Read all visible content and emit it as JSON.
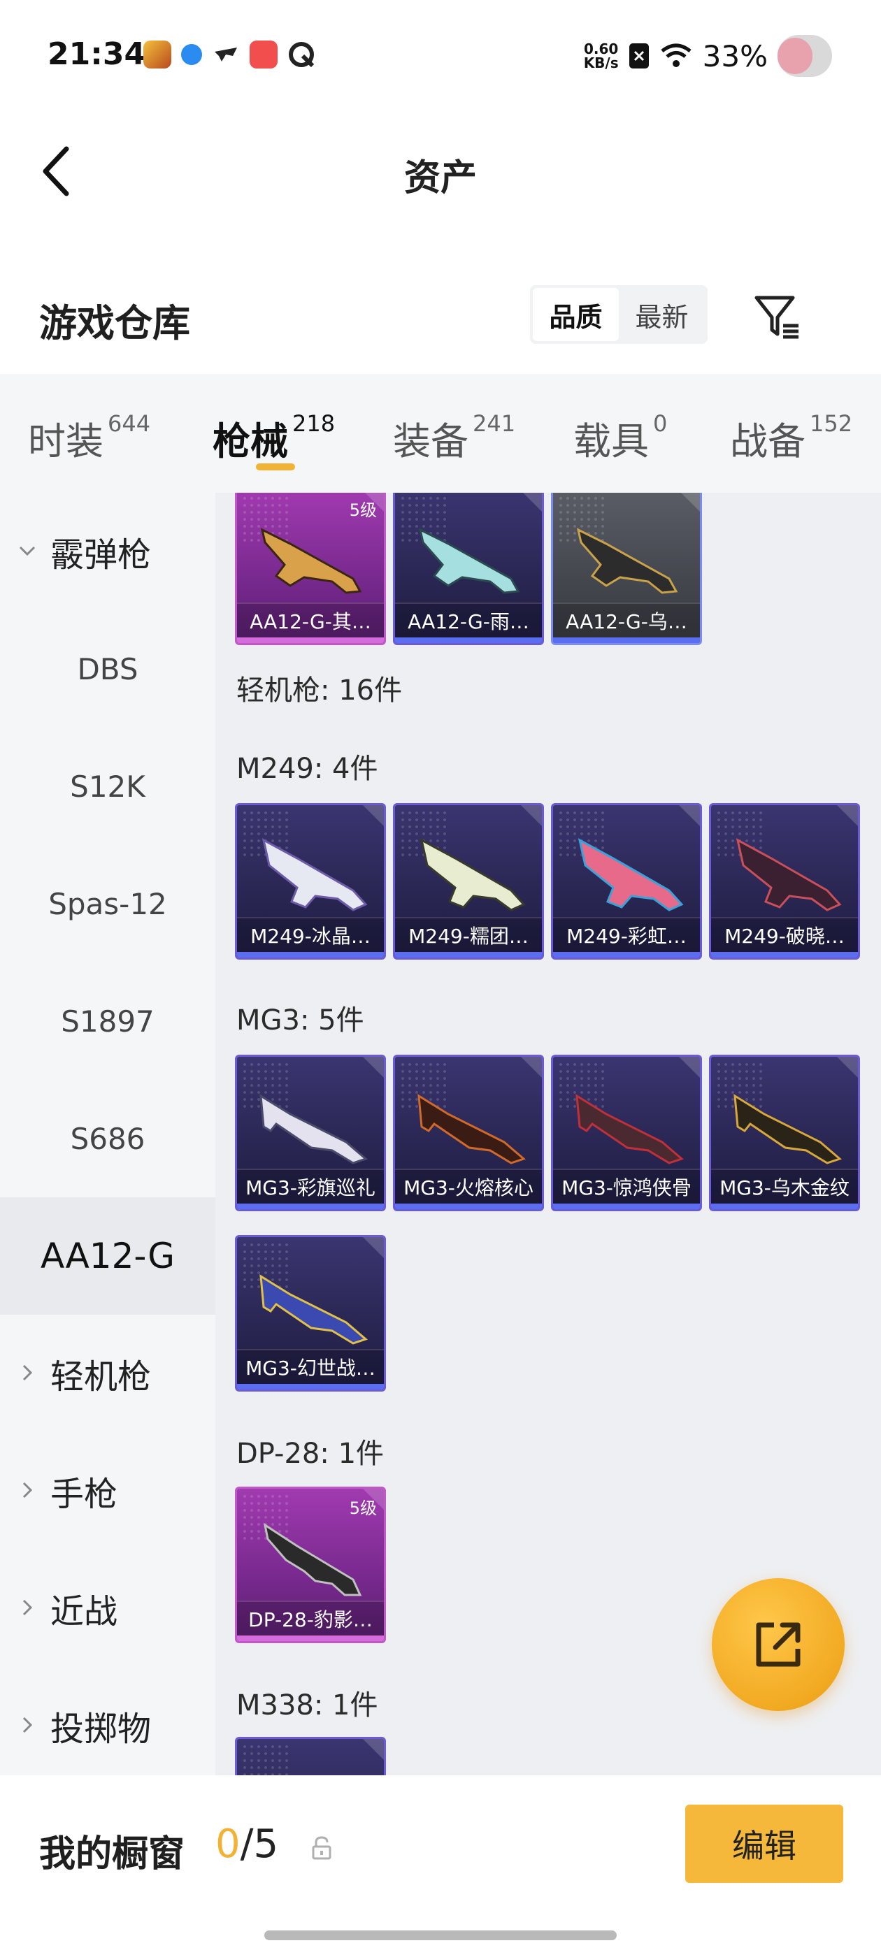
{
  "status_bar": {
    "time": "21:34",
    "net_speed_value": "0.60",
    "net_speed_unit": "KB/s",
    "battery": "33%",
    "app_icons": [
      "game-icon",
      "message-icon",
      "drone-icon",
      "app-icon",
      "browser-icon"
    ]
  },
  "header": {
    "title": "资产"
  },
  "warehouse": {
    "title": "游戏仓库",
    "sort_options": [
      "品质",
      "最新"
    ],
    "sort_active": "品质"
  },
  "tabs": [
    {
      "label": "时装",
      "count": "644"
    },
    {
      "label": "枪械",
      "count": "218"
    },
    {
      "label": "装备",
      "count": "241"
    },
    {
      "label": "载具",
      "count": "0"
    },
    {
      "label": "战备",
      "count": "152"
    }
  ],
  "active_tab": "枪械",
  "sidebar": [
    {
      "label": "霰弹枪",
      "type": "category",
      "expanded": true
    },
    {
      "label": "DBS",
      "type": "sub"
    },
    {
      "label": "S12K",
      "type": "sub"
    },
    {
      "label": "Spas-12",
      "type": "sub"
    },
    {
      "label": "S1897",
      "type": "sub"
    },
    {
      "label": "S686",
      "type": "sub"
    },
    {
      "label": "AA12-G",
      "type": "sub",
      "active": true
    },
    {
      "label": "轻机枪",
      "type": "category",
      "expanded": false
    },
    {
      "label": "手枪",
      "type": "category",
      "expanded": false
    },
    {
      "label": "近战",
      "type": "category",
      "expanded": false
    },
    {
      "label": "投掷物",
      "type": "category",
      "expanded": false
    }
  ],
  "content": {
    "aa12_items": [
      {
        "name": "AA12-G-其…",
        "level": "5级",
        "rarity": "gold"
      },
      {
        "name": "AA12-G-雨…",
        "rarity": "purple"
      },
      {
        "name": "AA12-G-乌…",
        "rarity": "gray"
      }
    ],
    "lmg_label": "轻机枪: 16件",
    "m249_label": "M249: 4件",
    "m249_items": [
      {
        "name": "M249-冰晶…",
        "rarity": "purple"
      },
      {
        "name": "M249-糯团…",
        "rarity": "purple"
      },
      {
        "name": "M249-彩虹…",
        "rarity": "purple"
      },
      {
        "name": "M249-破晓…",
        "rarity": "purple"
      }
    ],
    "mg3_label": "MG3: 5件",
    "mg3_items": [
      {
        "name": "MG3-彩旗巡礼",
        "rarity": "purple"
      },
      {
        "name": "MG3-火熔核心",
        "rarity": "purple"
      },
      {
        "name": "MG3-惊鸿侠骨",
        "rarity": "purple"
      },
      {
        "name": "MG3-乌木金纹",
        "rarity": "purple"
      },
      {
        "name": "MG3-幻世战…",
        "rarity": "purple"
      }
    ],
    "dp28_label": "DP-28: 1件",
    "dp28_items": [
      {
        "name": "DP-28-豹影…",
        "level": "5级",
        "rarity": "gold"
      }
    ],
    "m338_label": "M338: 1件"
  },
  "bottom": {
    "showcase_label": "我的橱窗",
    "showcase_current": "0",
    "showcase_total": "/5",
    "edit_label": "编辑"
  },
  "colors": {
    "accent": "#f2b233",
    "purple_card": "#2a2754",
    "gold_card": "#7a2a90",
    "gray_card": "#44464e"
  }
}
